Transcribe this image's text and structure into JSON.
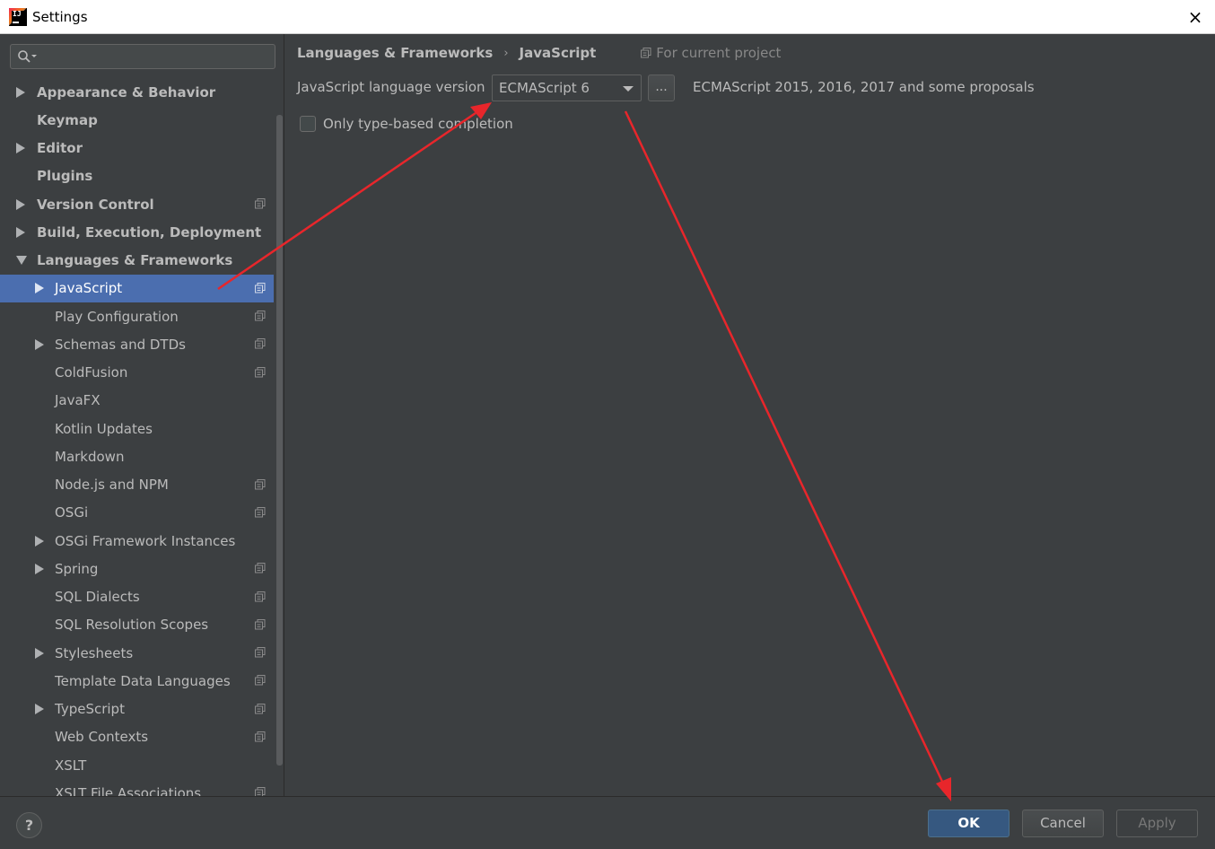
{
  "window": {
    "title": "Settings",
    "close_icon": "×"
  },
  "sidebar": {
    "search_placeholder": "",
    "items": [
      {
        "label": "Appearance & Behavior",
        "level": 0,
        "expander": "collapsed",
        "bold": true,
        "project_icon": false,
        "selected": false
      },
      {
        "label": "Keymap",
        "level": 0,
        "expander": "none",
        "bold": true,
        "project_icon": false,
        "selected": false
      },
      {
        "label": "Editor",
        "level": 0,
        "expander": "collapsed",
        "bold": true,
        "project_icon": false,
        "selected": false
      },
      {
        "label": "Plugins",
        "level": 0,
        "expander": "none",
        "bold": true,
        "project_icon": false,
        "selected": false
      },
      {
        "label": "Version Control",
        "level": 0,
        "expander": "collapsed",
        "bold": true,
        "project_icon": true,
        "selected": false
      },
      {
        "label": "Build, Execution, Deployment",
        "level": 0,
        "expander": "collapsed",
        "bold": true,
        "project_icon": false,
        "selected": false
      },
      {
        "label": "Languages & Frameworks",
        "level": 0,
        "expander": "expanded",
        "bold": true,
        "project_icon": false,
        "selected": false
      },
      {
        "label": "JavaScript",
        "level": 1,
        "expander": "collapsed",
        "bold": false,
        "project_icon": true,
        "selected": true
      },
      {
        "label": "Play Configuration",
        "level": 1,
        "expander": "none",
        "bold": false,
        "project_icon": true,
        "selected": false
      },
      {
        "label": "Schemas and DTDs",
        "level": 1,
        "expander": "collapsed",
        "bold": false,
        "project_icon": true,
        "selected": false
      },
      {
        "label": "ColdFusion",
        "level": 1,
        "expander": "none",
        "bold": false,
        "project_icon": true,
        "selected": false
      },
      {
        "label": "JavaFX",
        "level": 1,
        "expander": "none",
        "bold": false,
        "project_icon": false,
        "selected": false
      },
      {
        "label": "Kotlin Updates",
        "level": 1,
        "expander": "none",
        "bold": false,
        "project_icon": false,
        "selected": false
      },
      {
        "label": "Markdown",
        "level": 1,
        "expander": "none",
        "bold": false,
        "project_icon": false,
        "selected": false
      },
      {
        "label": "Node.js and NPM",
        "level": 1,
        "expander": "none",
        "bold": false,
        "project_icon": true,
        "selected": false
      },
      {
        "label": "OSGi",
        "level": 1,
        "expander": "none",
        "bold": false,
        "project_icon": true,
        "selected": false
      },
      {
        "label": "OSGi Framework Instances",
        "level": 1,
        "expander": "collapsed",
        "bold": false,
        "project_icon": false,
        "selected": false
      },
      {
        "label": "Spring",
        "level": 1,
        "expander": "collapsed",
        "bold": false,
        "project_icon": true,
        "selected": false
      },
      {
        "label": "SQL Dialects",
        "level": 1,
        "expander": "none",
        "bold": false,
        "project_icon": true,
        "selected": false
      },
      {
        "label": "SQL Resolution Scopes",
        "level": 1,
        "expander": "none",
        "bold": false,
        "project_icon": true,
        "selected": false
      },
      {
        "label": "Stylesheets",
        "level": 1,
        "expander": "collapsed",
        "bold": false,
        "project_icon": true,
        "selected": false
      },
      {
        "label": "Template Data Languages",
        "level": 1,
        "expander": "none",
        "bold": false,
        "project_icon": true,
        "selected": false
      },
      {
        "label": "TypeScript",
        "level": 1,
        "expander": "collapsed",
        "bold": false,
        "project_icon": true,
        "selected": false
      },
      {
        "label": "Web Contexts",
        "level": 1,
        "expander": "none",
        "bold": false,
        "project_icon": true,
        "selected": false
      },
      {
        "label": "XSLT",
        "level": 1,
        "expander": "none",
        "bold": false,
        "project_icon": false,
        "selected": false
      },
      {
        "label": "XSLT File Associations",
        "level": 1,
        "expander": "none",
        "bold": false,
        "project_icon": true,
        "selected": false
      }
    ]
  },
  "content": {
    "breadcrumb": [
      "Languages & Frameworks",
      "JavaScript"
    ],
    "breadcrumb_separator": "›",
    "scope_label": "For current project",
    "language_version_label": "JavaScript language version",
    "language_version_value": "ECMAScript 6",
    "ellipsis_label": "...",
    "language_version_description": "ECMAScript 2015, 2016, 2017 and some proposals",
    "type_based_completion_label": "Only type-based completion",
    "type_based_completion_checked": false
  },
  "footer": {
    "help_label": "?",
    "ok_label": "OK",
    "cancel_label": "Cancel",
    "apply_label": "Apply"
  },
  "colors": {
    "background": "#3c3f41",
    "selection": "#4b6eaf",
    "ok_button": "#365880",
    "annotation_arrow": "#e8262b"
  }
}
